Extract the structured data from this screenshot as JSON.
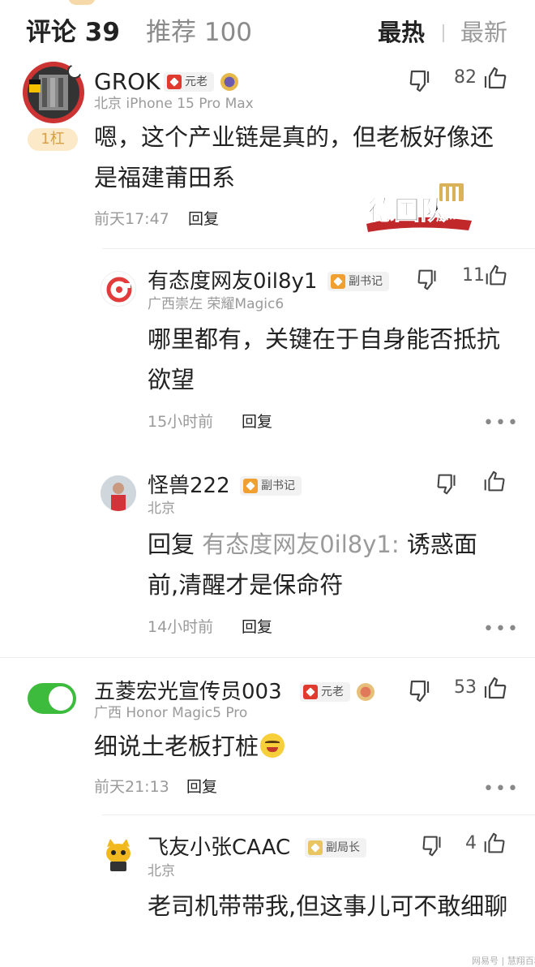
{
  "header": {
    "tab_comments": "评论 39",
    "tab_recommend": "推荐 100",
    "sort_hot": "最热",
    "sort_new": "最新"
  },
  "comments": [
    {
      "username": "GROK",
      "badge": "元老",
      "meta": "北京  iPhone 15 Pro Max",
      "floor_tag": "1杠",
      "text": "嗯，这个产业链是真的，但老板好像还是福建莆田系",
      "time": "前天17:47",
      "reply_label": "回复",
      "like_count": "82",
      "sticker_text": "德国队加油!"
    },
    {
      "username": "有态度网友0il8y1",
      "badge": "副书记",
      "meta": "广西崇左   荣耀Magic6",
      "text": "哪里都有，关键在于自身能否抵抗欲望",
      "time": "15小时前",
      "reply_label": "回复",
      "like_count": "11"
    },
    {
      "username": "怪兽222",
      "badge": "副书记",
      "meta": "北京",
      "reply_prefix": "回复 ",
      "reply_target": "有态度网友0il8y1:",
      "text": " 诱惑面前,清醒才是保命符",
      "time": "14小时前",
      "reply_label": "回复",
      "like_count": ""
    },
    {
      "username": "五菱宏光宣传员003",
      "badge": "元老",
      "meta": "广西  Honor Magic5 Pro",
      "text": "细说土老板打桩",
      "time": "前天21:13",
      "reply_label": "回复",
      "like_count": "53"
    },
    {
      "username": "飞友小张CAAC",
      "badge": "副局长",
      "meta": "北京",
      "text": "老司机带带我,但这事儿可不敢细聊",
      "like_count": "4"
    }
  ],
  "footer": "网易号 | 慧翔百科",
  "colors": {
    "floor_tag_bg": "#fbe9c7",
    "badge_red": "#e03a2f",
    "badge_orange": "#f0a030",
    "toggle_green": "#3dbb3d"
  }
}
